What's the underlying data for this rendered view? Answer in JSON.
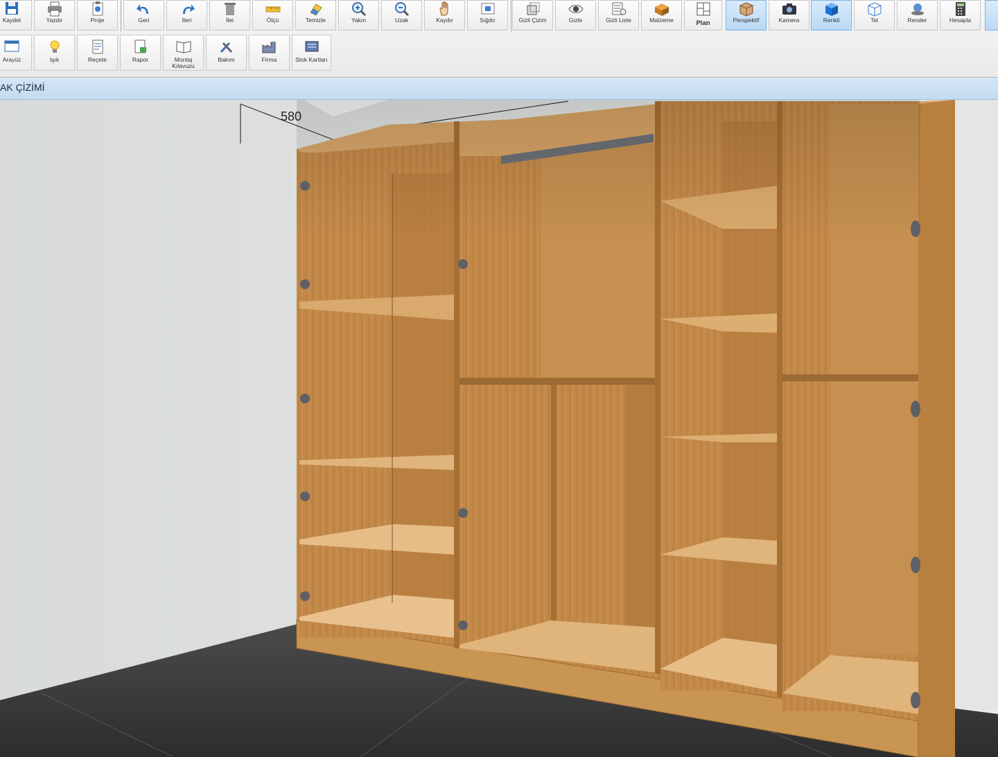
{
  "toolbar": {
    "row1": [
      {
        "label": "Kaydet",
        "icon": "save-icon"
      },
      {
        "label": "Yazdır",
        "icon": "printer-icon"
      },
      {
        "label": "Proje",
        "icon": "project-icon"
      },
      {
        "label": "Geri",
        "icon": "undo-icon"
      },
      {
        "label": "İleri",
        "icon": "redo-icon"
      },
      {
        "label": "İlei",
        "icon": "trash-icon"
      },
      {
        "label": "Ölçü",
        "icon": "ruler-icon"
      },
      {
        "label": "Temizle",
        "icon": "eraser-icon"
      },
      {
        "label": "Yakın",
        "icon": "zoom-in-icon"
      },
      {
        "label": "Uzak",
        "icon": "zoom-out-icon"
      },
      {
        "label": "Kaydır",
        "icon": "hand-icon"
      },
      {
        "label": "Sığdır",
        "icon": "fit-icon"
      },
      {
        "label": "Gizli Çizim",
        "icon": "hidden-lines-icon"
      },
      {
        "label": "Gizle",
        "icon": "eye-icon"
      },
      {
        "label": "Gizli Liste",
        "icon": "hidden-list-icon"
      },
      {
        "label": "Malzeme",
        "icon": "material-icon"
      },
      {
        "label": "Plan",
        "icon": "plan-icon"
      },
      {
        "label": "Perspektif",
        "icon": "perspective-icon"
      },
      {
        "label": "Kamera",
        "icon": "camera-icon"
      },
      {
        "label": "Renkli",
        "icon": "color-cube-icon"
      },
      {
        "label": "Tel",
        "icon": "wireframe-icon"
      },
      {
        "label": "Render",
        "icon": "render-icon"
      },
      {
        "label": "Hesapla",
        "icon": "calculator-icon"
      }
    ],
    "row2": [
      {
        "label": "Arayüz",
        "icon": "interface-icon"
      },
      {
        "label": "Işık",
        "icon": "light-bulb-icon"
      },
      {
        "label": "Reçete",
        "icon": "recipe-icon"
      },
      {
        "label": "Rapor",
        "icon": "report-icon"
      },
      {
        "label": "Montaj Kılavuzu",
        "icon": "manual-icon"
      },
      {
        "label": "Bakım",
        "icon": "tools-icon"
      },
      {
        "label": "Firma",
        "icon": "factory-icon"
      },
      {
        "label": "Stok Kartları",
        "icon": "stock-cards-icon"
      }
    ]
  },
  "title": "AK ÇİZİMİ",
  "dimension": "580",
  "colors": {
    "wood": "#c48a4a",
    "wood_dark": "#9c6a33",
    "wall": "#dcdfdd",
    "floor": "#3f3f40",
    "active_button": "#b9d9f5"
  }
}
